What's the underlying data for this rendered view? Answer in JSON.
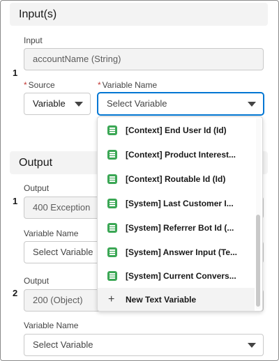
{
  "inputs": {
    "title": "Input(s)",
    "rows": [
      {
        "number": "1",
        "input_label": "Input",
        "input_value": "accountName (String)",
        "source_required": "*",
        "source_label": "Source",
        "source_value": "Variable",
        "varname_required": "*",
        "varname_label": "Variable Name",
        "varname_placeholder": "Select Variable"
      }
    ]
  },
  "dropdown": {
    "options": [
      {
        "label": "[Context] End User Id (Id)",
        "icon": "text-variable-icon"
      },
      {
        "label": "[Context] Product Interest...",
        "icon": "text-variable-icon"
      },
      {
        "label": "[Context] Routable Id (Id)",
        "icon": "text-variable-icon"
      },
      {
        "label": "[System] Last Customer I...",
        "icon": "text-variable-icon"
      },
      {
        "label": "[System] Referrer Bot Id (...",
        "icon": "text-variable-icon"
      },
      {
        "label": "[System] Answer Input (Te...",
        "icon": "text-variable-icon"
      },
      {
        "label": "[System] Current Convers...",
        "icon": "text-variable-icon"
      }
    ],
    "new_variable_label": "New Text Variable",
    "accent_color": "#3ba755"
  },
  "outputs": {
    "title": "Output",
    "rows": [
      {
        "number": "1",
        "output_label": "Output",
        "output_value": "400 Exception",
        "varname_label": "Variable Name",
        "varname_placeholder": "Select Variable"
      },
      {
        "number": "2",
        "output_label": "Output",
        "output_value": "200 (Object)",
        "varname_label": "Variable Name",
        "varname_placeholder": "Select Variable"
      }
    ]
  },
  "colors": {
    "focus_border": "#0176d3",
    "required": "#c23934",
    "section_bg": "#f3f3f3"
  }
}
